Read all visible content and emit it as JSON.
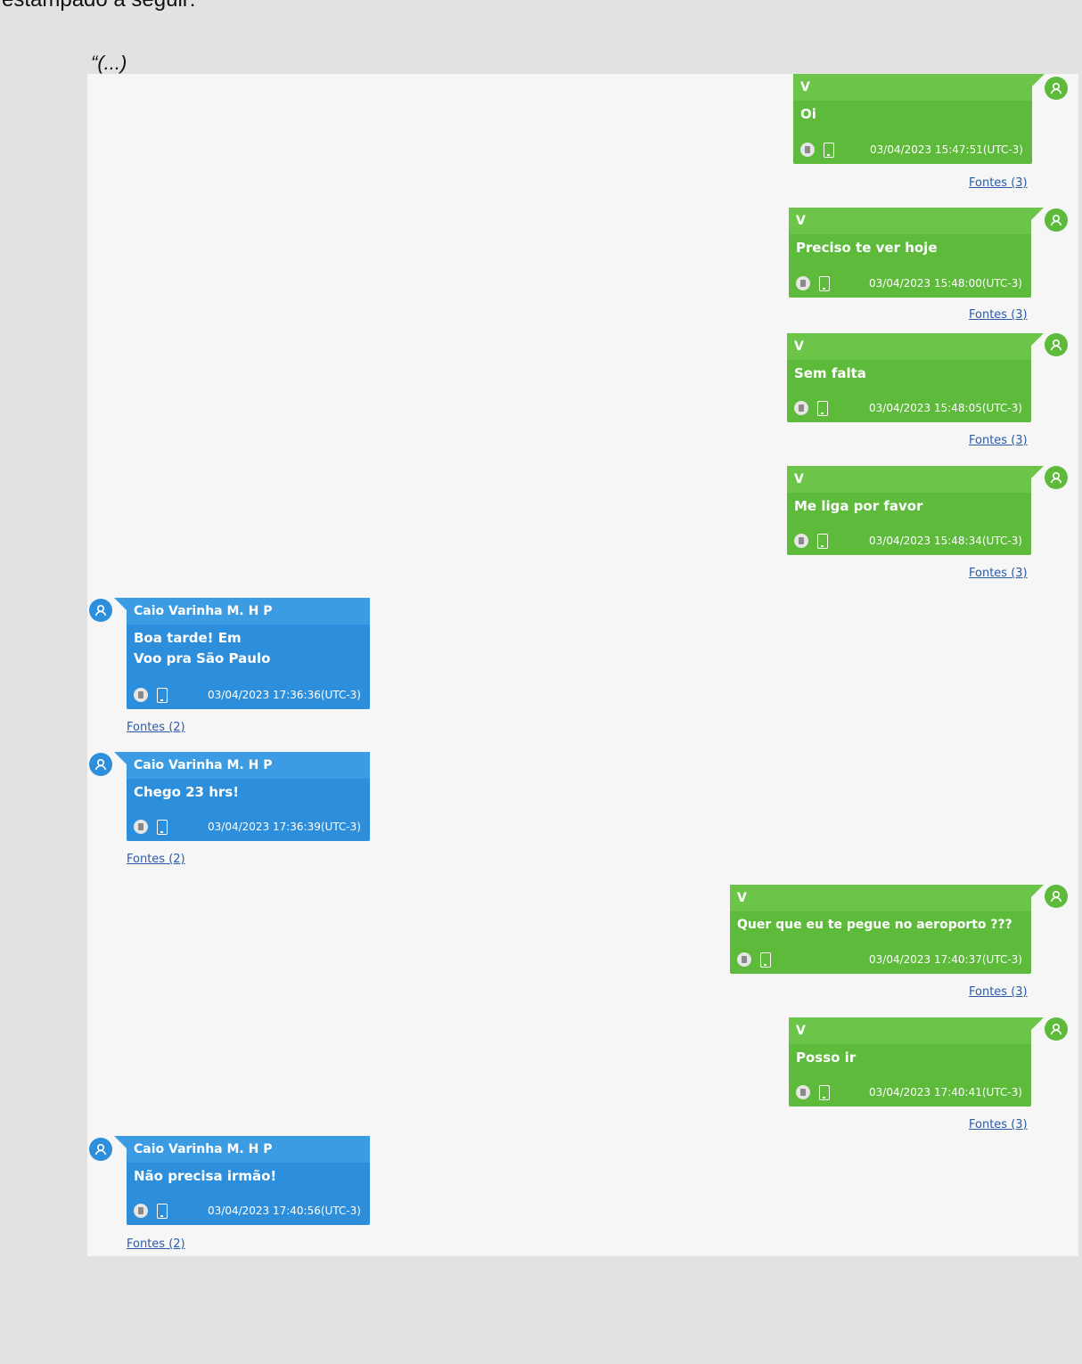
{
  "page": {
    "top_fragment": "estampado a seguir:",
    "quote_marker": "“(...)"
  },
  "messages": [
    {
      "side": "right",
      "sender": "V",
      "text": [
        "Oi"
      ],
      "timestamp": "03/04/2023 15:47:51(UTC-3)",
      "sources": "Fontes (3)"
    },
    {
      "side": "right",
      "sender": "V",
      "text": [
        "Preciso te ver hoje"
      ],
      "timestamp": "03/04/2023 15:48:00(UTC-3)",
      "sources": "Fontes (3)"
    },
    {
      "side": "right",
      "sender": "V",
      "text": [
        "Sem falta"
      ],
      "timestamp": "03/04/2023 15:48:05(UTC-3)",
      "sources": "Fontes (3)"
    },
    {
      "side": "right",
      "sender": "V",
      "text": [
        "Me liga por favor"
      ],
      "timestamp": "03/04/2023 15:48:34(UTC-3)",
      "sources": "Fontes (3)"
    },
    {
      "side": "left",
      "sender": "Caio Varinha M. H P",
      "text": [
        "Boa tarde! Em",
        "Voo pra São Paulo"
      ],
      "timestamp": "03/04/2023 17:36:36(UTC-3)",
      "sources": "Fontes (2)"
    },
    {
      "side": "left",
      "sender": "Caio Varinha M. H P",
      "text": [
        "Chego 23 hrs!"
      ],
      "timestamp": "03/04/2023 17:36:39(UTC-3)",
      "sources": "Fontes (2)"
    },
    {
      "side": "right",
      "sender": "V",
      "text": [
        "Quer que eu te pegue no aeroporto  ???"
      ],
      "timestamp": "03/04/2023 17:40:37(UTC-3)",
      "sources": "Fontes (3)"
    },
    {
      "side": "right",
      "sender": "V",
      "text": [
        "Posso ir"
      ],
      "timestamp": "03/04/2023 17:40:41(UTC-3)",
      "sources": "Fontes (3)"
    },
    {
      "side": "left",
      "sender": "Caio Varinha M. H P",
      "text": [
        "Não precisa irmão!"
      ],
      "timestamp": "03/04/2023 17:40:56(UTC-3)",
      "sources": "Fontes (2)"
    }
  ],
  "icons": {
    "avatar": "user-avatar-icon",
    "stamp": "message-status-icon",
    "device": "phone-icon"
  },
  "colors": {
    "outgoing_bubble": "#5dba3b",
    "incoming_bubble": "#2d8fdb",
    "link": "#2b5aa8",
    "panel_background": "#f6f6f6",
    "page_background": "#e2e2e2"
  }
}
